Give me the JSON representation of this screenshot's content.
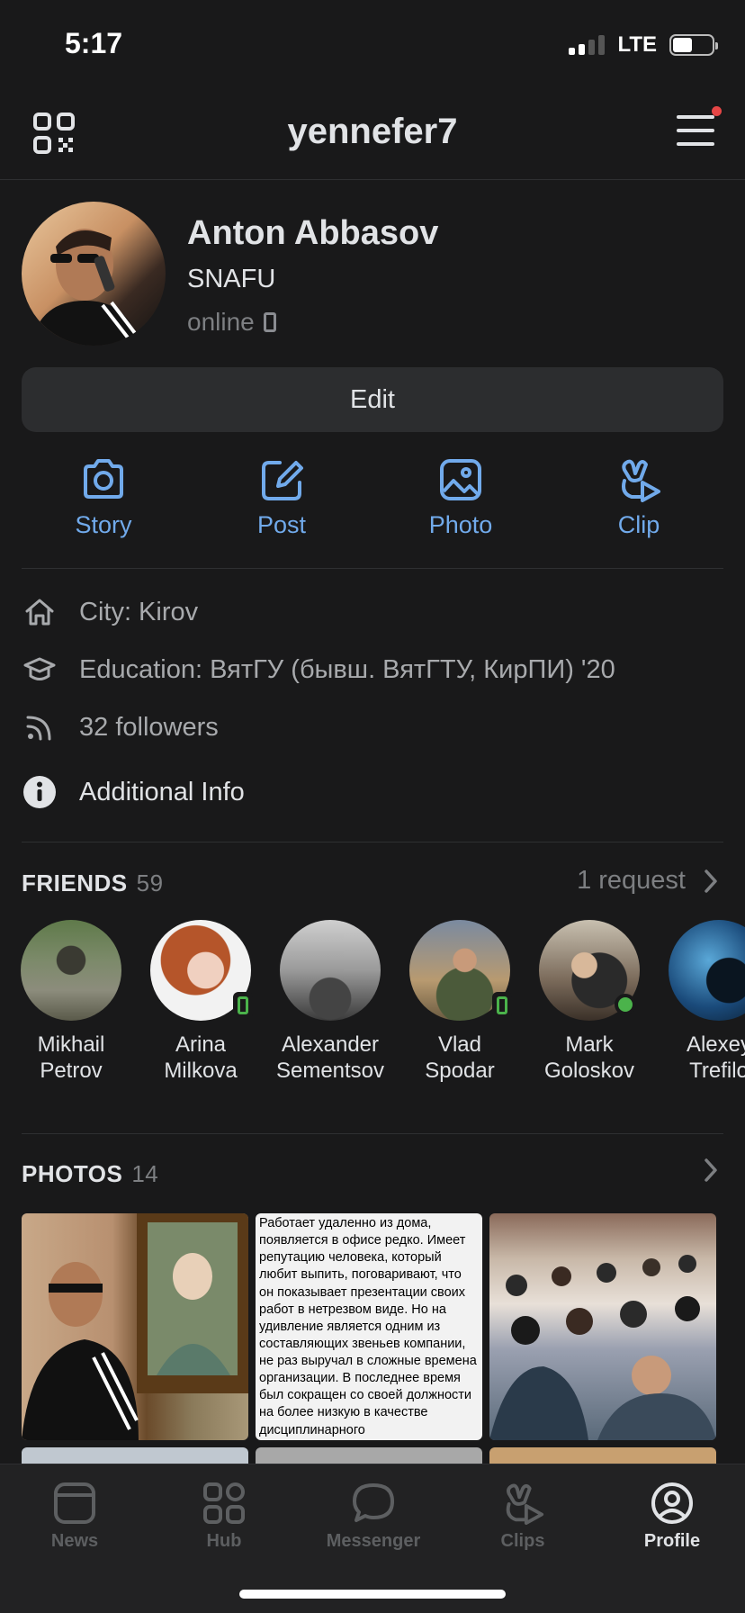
{
  "status_bar": {
    "time": "5:17",
    "network": "LTE"
  },
  "header": {
    "username": "yennefer7"
  },
  "profile": {
    "name": "Anton Abbasov",
    "status": "SNAFU",
    "online": "online",
    "edit_label": "Edit"
  },
  "actions": [
    {
      "label": "Story",
      "icon": "camera-icon"
    },
    {
      "label": "Post",
      "icon": "edit-icon"
    },
    {
      "label": "Photo",
      "icon": "image-icon"
    },
    {
      "label": "Clip",
      "icon": "clip-icon"
    }
  ],
  "info": {
    "city": "City: Kirov",
    "education": "Education: ВятГУ (бывш. ВятГТУ, КирПИ) '20",
    "followers": "32 followers",
    "additional": "Additional Info"
  },
  "friends": {
    "title": "FRIENDS",
    "count": "59",
    "requests": "1 request",
    "items": [
      {
        "first": "Mikhail",
        "last": "Petrov"
      },
      {
        "first": "Arina",
        "last": "Milkova"
      },
      {
        "first": "Alexander",
        "last": "Sementsov"
      },
      {
        "first": "Vlad",
        "last": "Spodar"
      },
      {
        "first": "Mark",
        "last": "Goloskov"
      },
      {
        "first": "Alexey",
        "last": "Trefilo"
      }
    ]
  },
  "photos": {
    "title": "PHOTOS",
    "count": "14",
    "text_photo": "Работает удаленно из дома, появляется в офисе редко. Имеет репутацию человека, который любит выпить, поговаривают, что он показывает презентации своих работ в нетрезвом виде. Но на удивление является одним из составляющих звеньев компании, не раз выручал в сложные времена организации. В последнее время был сокращен со своей должности на более низкую в качестве дисциплинарного"
  },
  "tabbar": {
    "tabs": [
      {
        "label": "News"
      },
      {
        "label": "Hub"
      },
      {
        "label": "Messenger"
      },
      {
        "label": "Clips"
      },
      {
        "label": "Profile"
      }
    ]
  },
  "colors": {
    "accent": "#71aaeb",
    "background": "#19191a",
    "online": "#4bb34b",
    "notification": "#e64646"
  }
}
